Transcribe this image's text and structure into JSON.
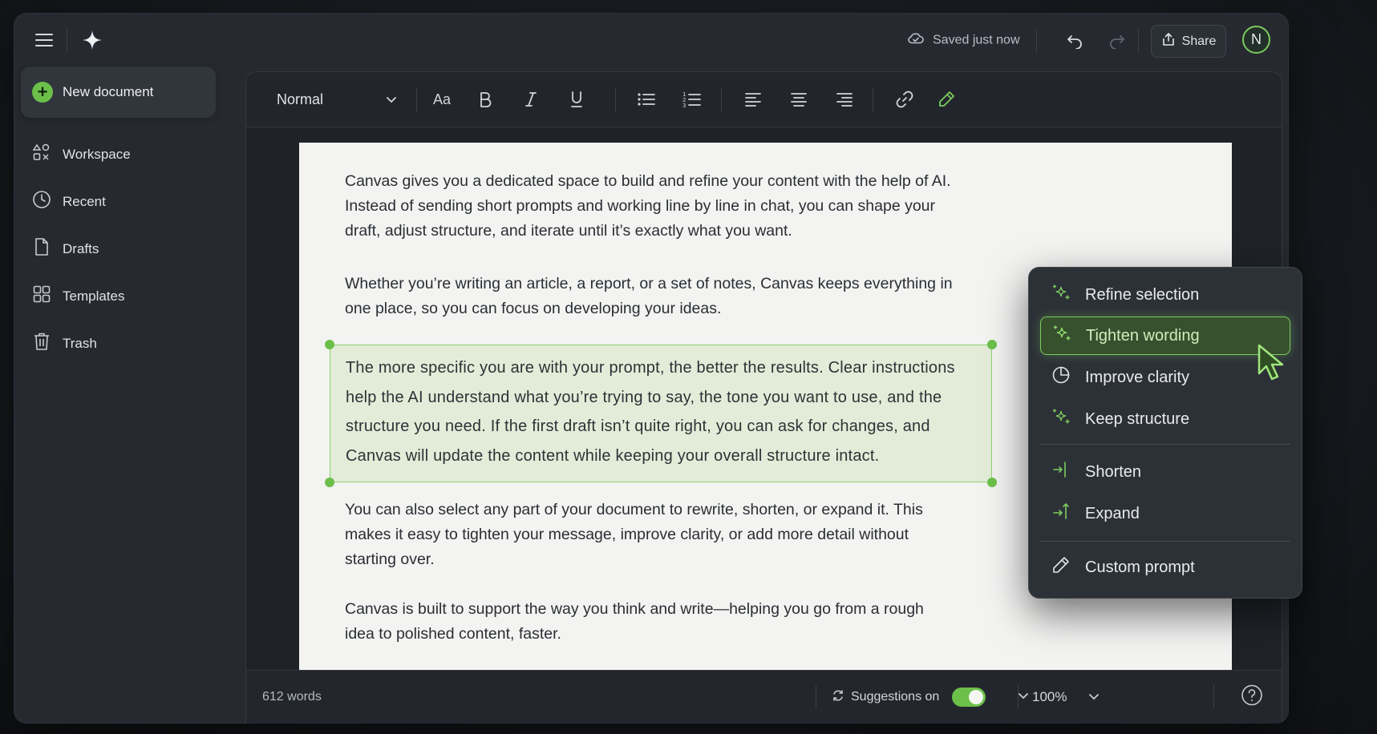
{
  "header": {
    "saved_status": "Saved just now",
    "share_label": "Share",
    "avatar_initial": "N"
  },
  "sidebar": {
    "new_document_label": "New document",
    "items": [
      {
        "label": "Workspace",
        "icon": "workspace-icon"
      },
      {
        "label": "Recent",
        "icon": "clock-icon"
      },
      {
        "label": "Drafts",
        "icon": "file-icon"
      },
      {
        "label": "Templates",
        "icon": "grid-icon"
      },
      {
        "label": "Trash",
        "icon": "trash-icon"
      }
    ]
  },
  "toolbar": {
    "style_value": "Normal",
    "font_size_label": "Aa",
    "buttons": [
      "bold-icon",
      "italic-icon",
      "underline-icon",
      "bullet-list-icon",
      "numbered-list-icon",
      "align-left-icon",
      "align-center-icon",
      "align-right-icon",
      "link-icon",
      "highlighter-icon"
    ]
  },
  "document": {
    "paragraphs": [
      "Canvas gives you a dedicated space to build and refine your content with the help of AI. Instead of sending short prompts and working line by line in chat, you can shape your draft, adjust structure, and iterate until it’s exactly what you want.",
      "Whether you’re writing an article, a report, or a set of notes, Canvas keeps everything in one place, so you can focus on developing your ideas.",
      "The more specific you are with your prompt, the better the results. Clear instructions help the AI understand what you’re trying to say, the tone you want to use, and the structure you need. If the first draft isn’t quite right, you can ask for changes, and Canvas will update the content while keeping your overall structure intact.",
      "You can also select any part of your document to rewrite, shorten, or expand it. This makes it easy to tighten your message, improve clarity, or add more detail without starting over.",
      "Canvas is built to support the way you think and write—helping you go from a rough idea to polished content, faster."
    ]
  },
  "statusbar": {
    "word_count": "612 words",
    "suggestions_label": "Suggestions on",
    "suggestions_enabled": true,
    "zoom": "100%"
  },
  "context_menu": {
    "items": [
      {
        "label": "Refine selection",
        "icon": "sparkle-icon"
      },
      {
        "label": "Tighten wording",
        "icon": "sparkle-icon",
        "active": true
      },
      {
        "label": "Improve clarity",
        "icon": "half-circle-icon"
      },
      {
        "label": "Keep structure",
        "icon": "sparkle-icon"
      },
      {
        "label": "Shorten",
        "icon": "shorten-icon"
      },
      {
        "label": "Expand",
        "icon": "expand-icon"
      },
      {
        "label": "Custom prompt",
        "icon": "pencil-icon"
      }
    ]
  },
  "colors": {
    "accent": "#6cc04a",
    "app_bg": "#262a30",
    "page_bg": "#f3f3f2",
    "selection_bg": "#e3ecd8"
  }
}
